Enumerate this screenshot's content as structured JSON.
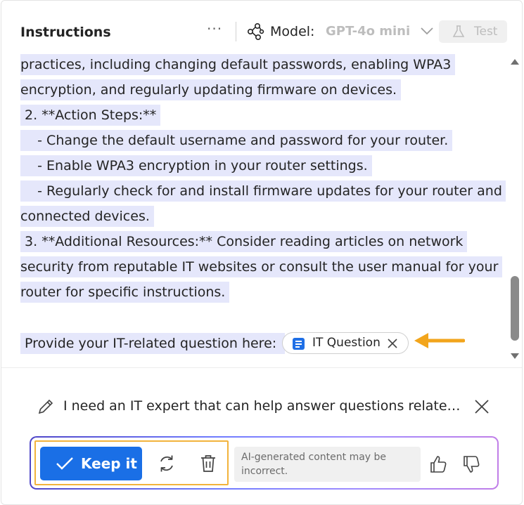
{
  "header": {
    "title": "Instructions",
    "more_label": "···",
    "model_label": "Model:",
    "model_value": "GPT-4o mini",
    "test_label": "Test",
    "icons": {
      "model": "model-graph-icon",
      "chevron": "chevron-down-icon",
      "test": "flask-icon",
      "more": "more-horizontal-icon"
    }
  },
  "content": {
    "lines": [
      "practices, including changing default passwords, enabling WPA3 ",
      "encryption, and regularly updating firmware on devices. ",
      " 2. **Action Steps:** ",
      "    - Change the default username and password for your router. ",
      "    - Enable WPA3 encryption in your router settings. ",
      "    - Regularly check for and install firmware updates for your router and ",
      "connected devices. ",
      " 3. **Additional Resources:** Consider reading articles on network ",
      "security from reputable IT websites or consult the user manual for your ",
      "router for specific instructions. "
    ],
    "question_prompt": " Provide your IT-related question here:  ",
    "chip_label": "IT Question"
  },
  "prompt": {
    "text": "I need an IT expert that can help answer questions related to IT troubleshooting"
  },
  "actions": {
    "keep_label": "Keep it",
    "ai_note": "AI-generated content may be incorrect."
  },
  "colors": {
    "accent": "#1a6fe6",
    "highlight": "#e5e7fb",
    "annotation_orange": "#f2b33c",
    "gradient_start": "#4f46c8",
    "gradient_end": "#c07ee8"
  }
}
